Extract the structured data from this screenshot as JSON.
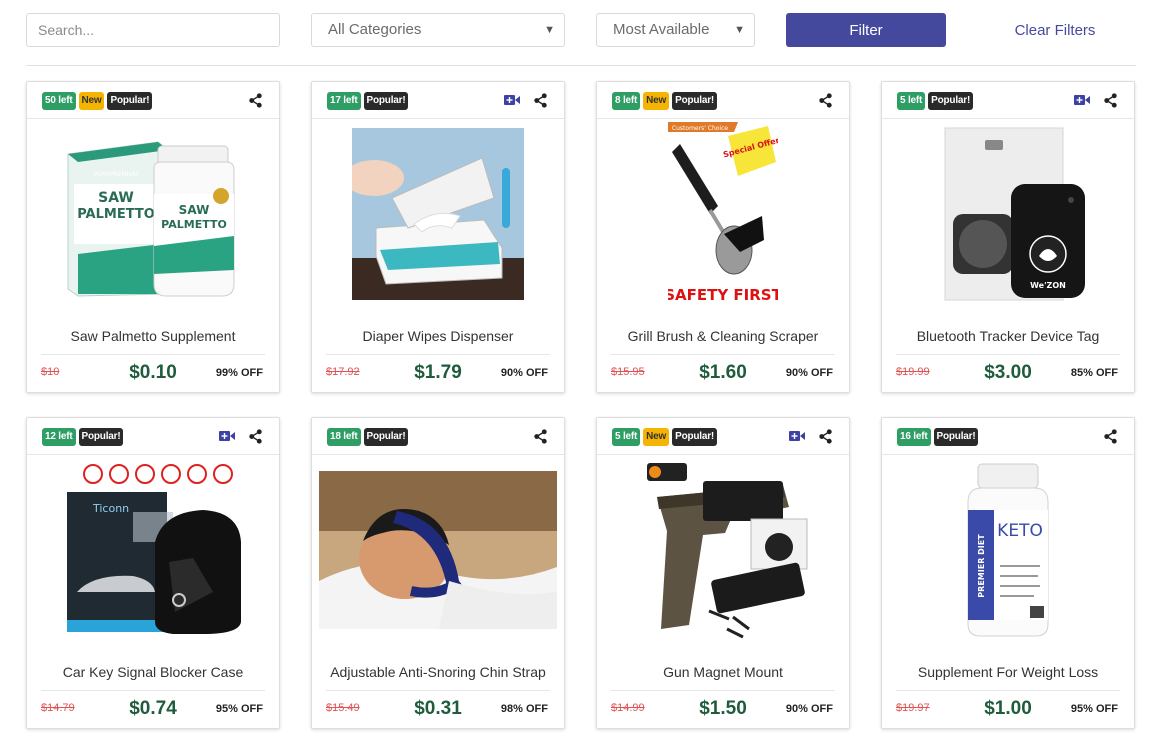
{
  "filters": {
    "search_placeholder": "Search...",
    "category": "All Categories",
    "sort": "Most Available",
    "filter_label": "Filter",
    "clear_label": "Clear Filters"
  },
  "colors": {
    "primary": "#45499e",
    "stock_badge": "#2e9e64",
    "new_badge": "#f5b400",
    "popular_badge": "#2a2a2a",
    "price": "#1e5c3b",
    "strike_price": "#e05353"
  },
  "products": [
    {
      "stock": "50 left",
      "new": "New",
      "popular": "Popular!",
      "video": false,
      "title": "Saw Palmetto Supplement",
      "orig": "$10",
      "price": "$0.10",
      "off": "99% OFF",
      "image": "supplement-bottle-box"
    },
    {
      "stock": "17 left",
      "popular": "Popular!",
      "video": true,
      "title": "Diaper Wipes Dispenser",
      "orig": "$17.92",
      "price": "$1.79",
      "off": "90% OFF",
      "image": "wipes-dispenser"
    },
    {
      "stock": "8 left",
      "new": "New",
      "popular": "Popular!",
      "video": false,
      "title": "Grill Brush & Cleaning Scraper",
      "orig": "$15.95",
      "price": "$1.60",
      "off": "90% OFF",
      "image": "grill-brush"
    },
    {
      "stock": "5 left",
      "popular": "Popular!",
      "video": true,
      "title": "Bluetooth Tracker Device Tag",
      "orig": "$19.99",
      "price": "$3.00",
      "off": "85% OFF",
      "image": "tracker-tag"
    },
    {
      "stock": "12 left",
      "popular": "Popular!",
      "video": true,
      "title": "Car Key Signal Blocker Case",
      "orig": "$14.79",
      "price": "$0.74",
      "off": "95% OFF",
      "image": "key-pouch"
    },
    {
      "stock": "18 left",
      "popular": "Popular!",
      "video": false,
      "title": "Adjustable Anti-Snoring Chin Strap",
      "orig": "$15.49",
      "price": "$0.31",
      "off": "98% OFF",
      "image": "chin-strap-photo"
    },
    {
      "stock": "5 left",
      "new": "New",
      "popular": "Popular!",
      "video": true,
      "title": "Gun Magnet Mount",
      "orig": "$14.99",
      "price": "$1.50",
      "off": "90% OFF",
      "image": "gun-magnet"
    },
    {
      "stock": "16 left",
      "popular": "Popular!",
      "video": false,
      "title": "Supplement For Weight Loss",
      "orig": "$19.97",
      "price": "$1.00",
      "off": "95% OFF",
      "image": "keto-bottle"
    }
  ],
  "image_text": {
    "saw_brand": "PUREPREMIUM",
    "saw_line1": "SAW",
    "saw_line2": "PALMETTO",
    "grill_tag": "Special Offer",
    "grill_ribbon": "Customers' Choice",
    "grill_caption": "SAFETY FIRST",
    "tracker_brand": "We'ZON",
    "key_brand": "Ticonn",
    "keto_brand": "KETO",
    "keto_side": "PREMIER DIET"
  }
}
